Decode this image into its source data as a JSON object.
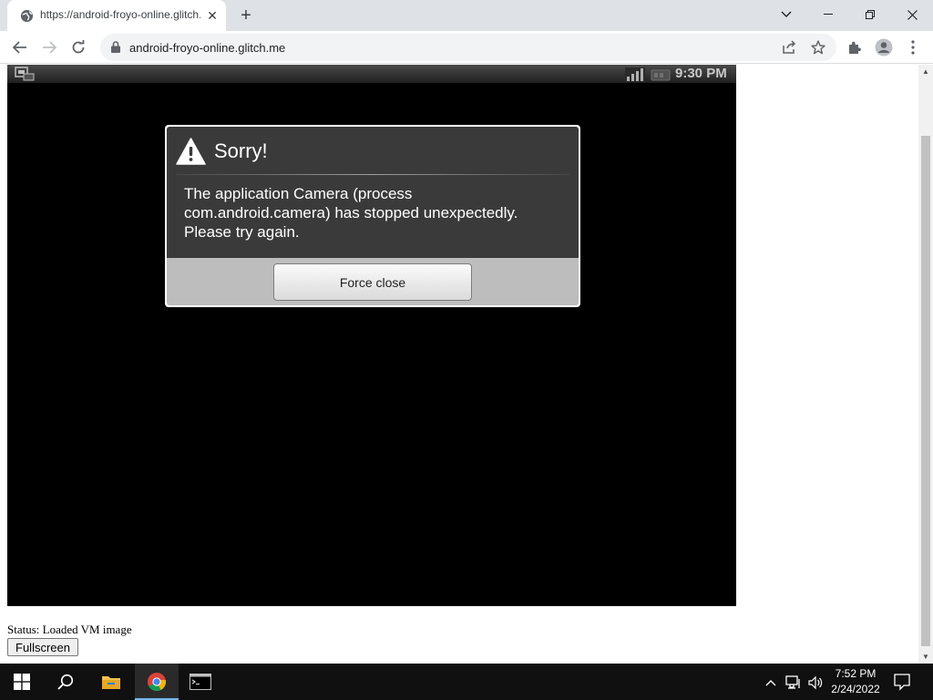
{
  "browser": {
    "tab": {
      "title": "https://android-froyo-online.glitch.me",
      "favicon": "globe-icon"
    },
    "url": "android-froyo-online.glitch.me"
  },
  "android": {
    "statusbar": {
      "time": "9:30 PM"
    },
    "dialog": {
      "title": "Sorry!",
      "message": "The application Camera (process com.android.camera) has stopped unexpectedly. Please try again.",
      "button": "Force close",
      "icon": "alert-icon"
    }
  },
  "page": {
    "status": "Status: Loaded VM image",
    "fullscreen_label": "Fullscreen"
  },
  "taskbar": {
    "time": "7:52 PM",
    "date": "2/24/2022",
    "apps": [
      "start-icon",
      "search-icon",
      "file-explorer-icon",
      "chrome-icon",
      "terminal-icon"
    ]
  },
  "colors": {
    "dialog_body": "#3a3a3a",
    "dialog_footer": "#bdbdbd",
    "screen": "#000000",
    "taskbar": "#101010",
    "active_indicator": "#76b9ed"
  }
}
